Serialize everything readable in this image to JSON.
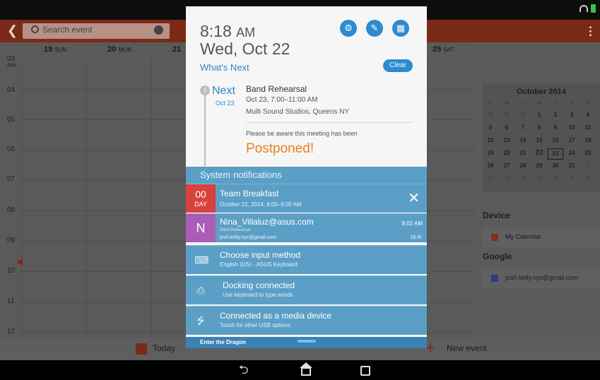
{
  "calendar": {
    "search_placeholder": "Search event",
    "day_headers": [
      {
        "num": "19",
        "name": "SUN"
      },
      {
        "num": "20",
        "name": "MON"
      },
      {
        "num": "21",
        "name": ""
      },
      {
        "num": "25",
        "name": "SAT"
      }
    ],
    "ampm_label": "AM",
    "hours": [
      "03",
      "04",
      "05",
      "06",
      "07",
      "08",
      "09",
      "10",
      "11",
      "12"
    ],
    "mini_title": "October 2014",
    "mini_weekdays": [
      "S",
      "M",
      "T",
      "W",
      "T",
      "F",
      "S"
    ],
    "mini_days": [
      [
        "28",
        "29",
        "30",
        "1",
        "2",
        "3",
        "4"
      ],
      [
        "5",
        "6",
        "7",
        "8",
        "9",
        "10",
        "11"
      ],
      [
        "12",
        "13",
        "14",
        "15",
        "16",
        "17",
        "18"
      ],
      [
        "19",
        "20",
        "21",
        "22",
        "23",
        "24",
        "25"
      ],
      [
        "26",
        "27",
        "28",
        "29",
        "30",
        "31",
        "1"
      ],
      [
        "2",
        "3",
        "4",
        "5",
        "6",
        "7",
        "8"
      ]
    ],
    "section_device": "Device",
    "device_account": "My Calendar",
    "device_color": "#8b2d1c",
    "section_google": "Google",
    "google_account": "josh.kelly.nyc@gmail.com",
    "google_color": "#2d3b8b",
    "today_label": "Today",
    "new_event_label": "New event",
    "accent_color": "#7a2a17"
  },
  "shade": {
    "time": "8:18",
    "ampm": "AM",
    "date": "Wed, Oct 22",
    "quick_icons": [
      "settings-icon",
      "edit-icon",
      "apps-icon"
    ],
    "whats_next": "What's Next",
    "clear": "Clear",
    "next_index": "1",
    "next_label": "Next",
    "next_date": "Oct 23",
    "event": {
      "title": "Band Rehearsal",
      "time": "Oct 23, 7:00–11:00 AM",
      "location": "Multi Sound Studios, Queens NY",
      "note": "Please be aware this meeting has been",
      "status": "Postponed!"
    },
    "system_header": "System notifications",
    "notifications": [
      {
        "title": "Team Breakfast",
        "detail": "October 22, 2014, 8:00–9:00 AM",
        "badge_num": "00",
        "badge_unit": "DAY"
      },
      {
        "title": "Nina_Villaluz@asus.com",
        "sub": "Band Rehearsal",
        "account": "josh.kelly.nyc@gmail.com",
        "time": "8:02 AM",
        "count": "16",
        "avatar": "N"
      },
      {
        "title": "Choose input method",
        "detail": "English (US) - ASUS Keyboard",
        "icon": "keyboard-icon"
      },
      {
        "title": "Docking connected",
        "detail": "Use keyboard to type words",
        "icon": "dock-icon"
      },
      {
        "title": "Connected as a media device",
        "detail": "Touch for other USB options.",
        "icon": "usb-icon"
      }
    ],
    "footer": "Enter the Dragon"
  }
}
